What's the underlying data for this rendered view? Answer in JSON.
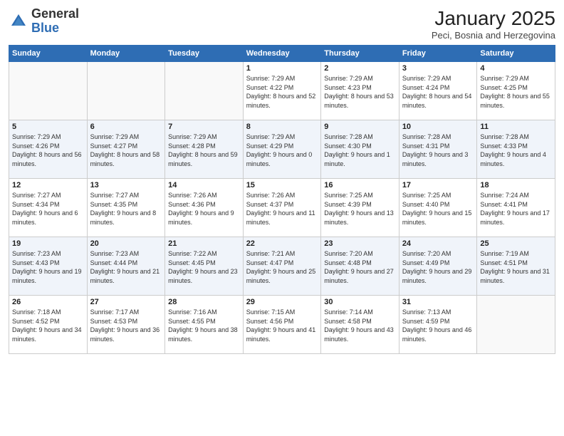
{
  "header": {
    "logo_general": "General",
    "logo_blue": "Blue",
    "month": "January 2025",
    "location": "Peci, Bosnia and Herzegovina"
  },
  "weekdays": [
    "Sunday",
    "Monday",
    "Tuesday",
    "Wednesday",
    "Thursday",
    "Friday",
    "Saturday"
  ],
  "weeks": [
    [
      {
        "day": "",
        "info": ""
      },
      {
        "day": "",
        "info": ""
      },
      {
        "day": "",
        "info": ""
      },
      {
        "day": "1",
        "info": "Sunrise: 7:29 AM\nSunset: 4:22 PM\nDaylight: 8 hours and 52 minutes."
      },
      {
        "day": "2",
        "info": "Sunrise: 7:29 AM\nSunset: 4:23 PM\nDaylight: 8 hours and 53 minutes."
      },
      {
        "day": "3",
        "info": "Sunrise: 7:29 AM\nSunset: 4:24 PM\nDaylight: 8 hours and 54 minutes."
      },
      {
        "day": "4",
        "info": "Sunrise: 7:29 AM\nSunset: 4:25 PM\nDaylight: 8 hours and 55 minutes."
      }
    ],
    [
      {
        "day": "5",
        "info": "Sunrise: 7:29 AM\nSunset: 4:26 PM\nDaylight: 8 hours and 56 minutes."
      },
      {
        "day": "6",
        "info": "Sunrise: 7:29 AM\nSunset: 4:27 PM\nDaylight: 8 hours and 58 minutes."
      },
      {
        "day": "7",
        "info": "Sunrise: 7:29 AM\nSunset: 4:28 PM\nDaylight: 8 hours and 59 minutes."
      },
      {
        "day": "8",
        "info": "Sunrise: 7:29 AM\nSunset: 4:29 PM\nDaylight: 9 hours and 0 minutes."
      },
      {
        "day": "9",
        "info": "Sunrise: 7:28 AM\nSunset: 4:30 PM\nDaylight: 9 hours and 1 minute."
      },
      {
        "day": "10",
        "info": "Sunrise: 7:28 AM\nSunset: 4:31 PM\nDaylight: 9 hours and 3 minutes."
      },
      {
        "day": "11",
        "info": "Sunrise: 7:28 AM\nSunset: 4:33 PM\nDaylight: 9 hours and 4 minutes."
      }
    ],
    [
      {
        "day": "12",
        "info": "Sunrise: 7:27 AM\nSunset: 4:34 PM\nDaylight: 9 hours and 6 minutes."
      },
      {
        "day": "13",
        "info": "Sunrise: 7:27 AM\nSunset: 4:35 PM\nDaylight: 9 hours and 8 minutes."
      },
      {
        "day": "14",
        "info": "Sunrise: 7:26 AM\nSunset: 4:36 PM\nDaylight: 9 hours and 9 minutes."
      },
      {
        "day": "15",
        "info": "Sunrise: 7:26 AM\nSunset: 4:37 PM\nDaylight: 9 hours and 11 minutes."
      },
      {
        "day": "16",
        "info": "Sunrise: 7:25 AM\nSunset: 4:39 PM\nDaylight: 9 hours and 13 minutes."
      },
      {
        "day": "17",
        "info": "Sunrise: 7:25 AM\nSunset: 4:40 PM\nDaylight: 9 hours and 15 minutes."
      },
      {
        "day": "18",
        "info": "Sunrise: 7:24 AM\nSunset: 4:41 PM\nDaylight: 9 hours and 17 minutes."
      }
    ],
    [
      {
        "day": "19",
        "info": "Sunrise: 7:23 AM\nSunset: 4:43 PM\nDaylight: 9 hours and 19 minutes."
      },
      {
        "day": "20",
        "info": "Sunrise: 7:23 AM\nSunset: 4:44 PM\nDaylight: 9 hours and 21 minutes."
      },
      {
        "day": "21",
        "info": "Sunrise: 7:22 AM\nSunset: 4:45 PM\nDaylight: 9 hours and 23 minutes."
      },
      {
        "day": "22",
        "info": "Sunrise: 7:21 AM\nSunset: 4:47 PM\nDaylight: 9 hours and 25 minutes."
      },
      {
        "day": "23",
        "info": "Sunrise: 7:20 AM\nSunset: 4:48 PM\nDaylight: 9 hours and 27 minutes."
      },
      {
        "day": "24",
        "info": "Sunrise: 7:20 AM\nSunset: 4:49 PM\nDaylight: 9 hours and 29 minutes."
      },
      {
        "day": "25",
        "info": "Sunrise: 7:19 AM\nSunset: 4:51 PM\nDaylight: 9 hours and 31 minutes."
      }
    ],
    [
      {
        "day": "26",
        "info": "Sunrise: 7:18 AM\nSunset: 4:52 PM\nDaylight: 9 hours and 34 minutes."
      },
      {
        "day": "27",
        "info": "Sunrise: 7:17 AM\nSunset: 4:53 PM\nDaylight: 9 hours and 36 minutes."
      },
      {
        "day": "28",
        "info": "Sunrise: 7:16 AM\nSunset: 4:55 PM\nDaylight: 9 hours and 38 minutes."
      },
      {
        "day": "29",
        "info": "Sunrise: 7:15 AM\nSunset: 4:56 PM\nDaylight: 9 hours and 41 minutes."
      },
      {
        "day": "30",
        "info": "Sunrise: 7:14 AM\nSunset: 4:58 PM\nDaylight: 9 hours and 43 minutes."
      },
      {
        "day": "31",
        "info": "Sunrise: 7:13 AM\nSunset: 4:59 PM\nDaylight: 9 hours and 46 minutes."
      },
      {
        "day": "",
        "info": ""
      }
    ]
  ]
}
